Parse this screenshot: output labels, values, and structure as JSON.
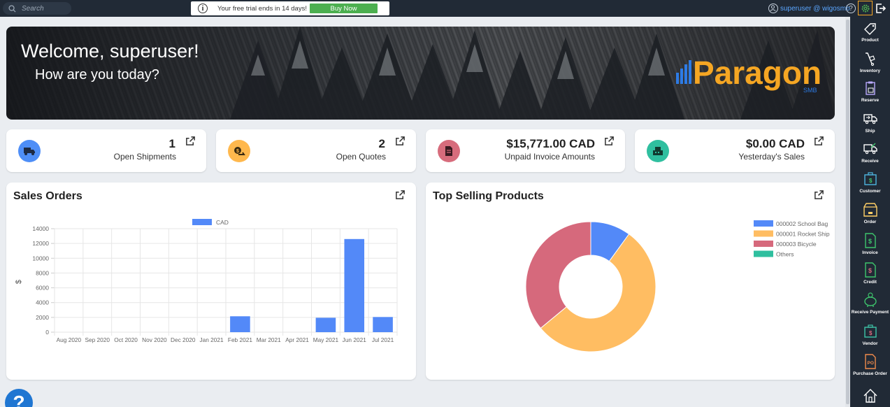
{
  "topbar": {
    "search_placeholder": "Search",
    "trial_text": "Your free trial ends in 14 days!",
    "buy_label": "Buy Now",
    "user_label": "superuser @ wigosmb",
    "help_glyph": "?"
  },
  "banner": {
    "welcome": "Welcome, superuser!",
    "subtitle": "How are you today?",
    "logo_text": "Paragon",
    "logo_sub": "SMB"
  },
  "cards": [
    {
      "value": "1",
      "label": "Open Shipments",
      "color": "#4e8ef7",
      "icon": "truck-icon"
    },
    {
      "value": "2",
      "label": "Open Quotes",
      "color": "#ffb84d",
      "icon": "quote-icon"
    },
    {
      "value": "$15,771.00 CAD",
      "label": "Unpaid Invoice Amounts",
      "color": "#d76c7c",
      "icon": "invoice-icon"
    },
    {
      "value": "$0.00 CAD",
      "label": "Yesterday's Sales",
      "color": "#2fbf9f",
      "icon": "register-icon"
    }
  ],
  "sales_panel": {
    "title": "Sales Orders"
  },
  "top_panel": {
    "title": "Top Selling Products"
  },
  "chart_data": [
    {
      "type": "bar",
      "categories": [
        "Aug 2020",
        "Sep 2020",
        "Oct 2020",
        "Nov 2020",
        "Dec 2020",
        "Jan 2021",
        "Feb 2021",
        "Mar 2021",
        "Apr 2021",
        "May 2021",
        "Jun 2021",
        "Jul 2021"
      ],
      "series": [
        {
          "name": "CAD",
          "values": [
            0,
            0,
            0,
            0,
            0,
            0,
            2150,
            0,
            0,
            1950,
            12600,
            2050
          ],
          "color": "#5389f8"
        }
      ],
      "ylabel": "$",
      "ylim": [
        0,
        14000
      ],
      "yticks": [
        0,
        2000,
        4000,
        6000,
        8000,
        10000,
        12000,
        14000
      ],
      "grid": true,
      "legend": "top-center"
    },
    {
      "type": "pie",
      "donut": true,
      "labels": [
        "000002 School Bag",
        "000001 Rocket Ship",
        "000003 Bicycle",
        "Others"
      ],
      "values": [
        10,
        54,
        36,
        0
      ],
      "colors": [
        "#5389f8",
        "#ffbd62",
        "#d6697c",
        "#2fbf9f"
      ],
      "legend": "right"
    }
  ],
  "sidebar": {
    "items": [
      {
        "label": "Product",
        "icon": "tag-icon",
        "color": "#fff"
      },
      {
        "label": "Inventory",
        "icon": "hand-truck-icon",
        "color": "#fff"
      },
      {
        "label": "Reserve",
        "icon": "clipboard-icon",
        "color": "#b9a9ff"
      },
      {
        "label": "Ship",
        "icon": "ship-truck-icon",
        "color": "#fff"
      },
      {
        "label": "Receive",
        "icon": "receive-truck-icon",
        "color": "#fff"
      },
      {
        "label": "Customer",
        "icon": "customer-icon",
        "color": "#4fb6e0"
      },
      {
        "label": "Order",
        "icon": "order-box-icon",
        "color": "#ffcf66"
      },
      {
        "label": "Invoice",
        "icon": "invoice-doc-icon",
        "color": "#3ec56c"
      },
      {
        "label": "Credit",
        "icon": "credit-doc-icon",
        "color": "#3ec56c"
      },
      {
        "label": "Receive Payment",
        "icon": "piggy-bank-icon",
        "color": "#3ec56c"
      },
      {
        "label": "Vendor",
        "icon": "vendor-icon",
        "color": "#3ec5a8"
      },
      {
        "label": "Purchase Order",
        "icon": "po-doc-icon",
        "color": "#f08a4b"
      },
      {
        "label": "",
        "icon": "home-icon",
        "color": "#fff"
      }
    ]
  }
}
